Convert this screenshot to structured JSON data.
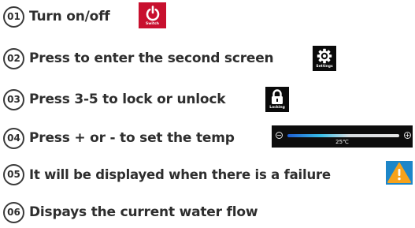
{
  "items": [
    {
      "number": "01",
      "text": "Turn on/off"
    },
    {
      "number": "02",
      "text": "Press to enter the second screen"
    },
    {
      "number": "03",
      "text": "Press 3-5 to lock or unlock"
    },
    {
      "number": "04",
      "text": "Press + or - to set the temp"
    },
    {
      "number": "05",
      "text": "It will be displayed when there is a failure"
    },
    {
      "number": "06",
      "text": "Dispays the current water flow"
    }
  ],
  "icons": {
    "switch": {
      "caption": "Switch",
      "name": "power-icon",
      "color": "#c8102e"
    },
    "settings": {
      "caption": "Settings",
      "name": "gear-icon",
      "color": "#0a0a0a"
    },
    "locking": {
      "caption": "Locking",
      "name": "lock-icon",
      "color": "#0a0a0a"
    },
    "warning": {
      "name": "warning-icon",
      "color": "#f7a21b"
    }
  },
  "temperature": {
    "minus": "−",
    "plus": "+",
    "value_label": "25℃"
  }
}
